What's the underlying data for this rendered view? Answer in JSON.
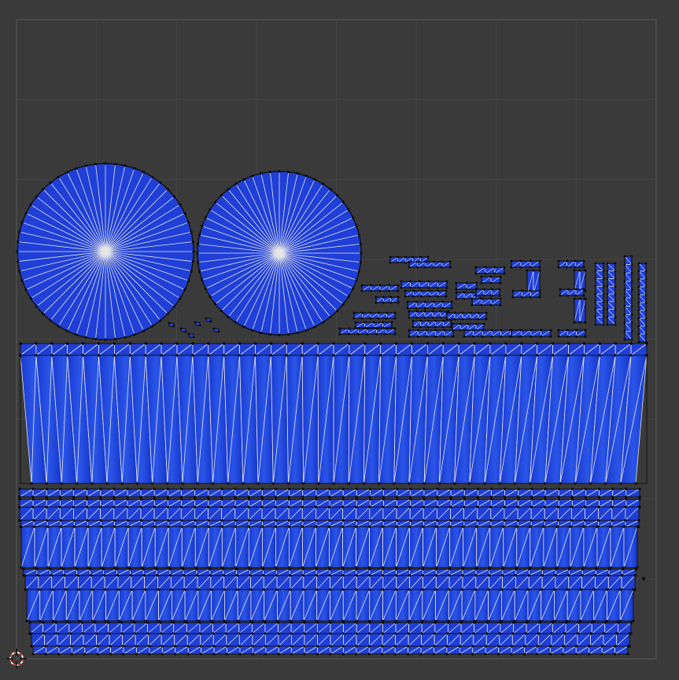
{
  "editor": {
    "type": "uv-editor",
    "background_color": "#3a3a3a",
    "grid": true,
    "grid_major_color": "#454545",
    "grid_minor_color": "#404040",
    "uv_tile_border_color": "#5a5a5a"
  },
  "uv_island": {
    "face_fill_color": "#1f3fd6",
    "face_fill_dark": "#1230c0",
    "edge_color": "#e6e6e6",
    "vertex_color": "#0a0a0a",
    "outline_color": "#111111"
  },
  "cursor": {
    "icon": "2d-cursor-icon",
    "color_outer": "#e04a3a",
    "color_inner": "#ffffff"
  }
}
